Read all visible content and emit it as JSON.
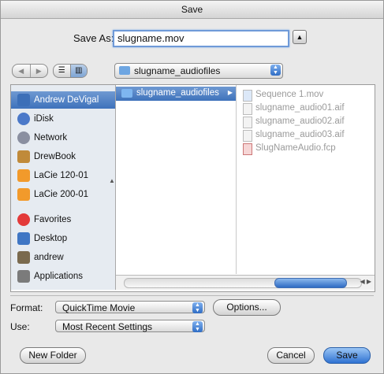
{
  "window": {
    "title": "Save"
  },
  "saveas": {
    "label": "Save As:",
    "value": "slugname.mov",
    "disclosure_icon": "triangle-up"
  },
  "toolbar": {
    "back_icon": "◀",
    "forward_icon": "▶",
    "list_view_icon": "☰",
    "column_view_icon": "▥",
    "path_value": "slugname_audiofiles"
  },
  "sidebar": {
    "items": [
      {
        "label": "Andrew DeVigal",
        "icon": "computer-icon",
        "color": "#3c6fb8"
      },
      {
        "label": "iDisk",
        "icon": "idisk-icon",
        "color": "#4b79c9"
      },
      {
        "label": "Network",
        "icon": "network-icon",
        "color": "#8a8fa0"
      },
      {
        "label": "DrewBook",
        "icon": "drive-icon",
        "color": "#c08a3a"
      },
      {
        "label": "LaCie 120-01",
        "icon": "disk-icon",
        "color": "#f29a2b"
      },
      {
        "label": "LaCie 200-01",
        "icon": "disk-icon",
        "color": "#f29a2b"
      },
      {
        "label": "Favorites",
        "icon": "heart-icon",
        "color": "#e33a3a"
      },
      {
        "label": "Desktop",
        "icon": "desktop-icon",
        "color": "#3f76c4"
      },
      {
        "label": "andrew",
        "icon": "home-icon",
        "color": "#7a6a4e"
      },
      {
        "label": "Applications",
        "icon": "applications-icon",
        "color": "#7b7b7b"
      }
    ]
  },
  "columns": {
    "col1_selected": "slugname_audiofiles",
    "files": [
      "Sequence 1.mov",
      "slugname_audio01.aif",
      "slugname_audio02.aif",
      "slugname_audio03.aif",
      "SlugNameAudio.fcp"
    ]
  },
  "options": {
    "format_label": "Format:",
    "format_value": "QuickTime Movie",
    "options_button": "Options...",
    "use_label": "Use:",
    "use_value": "Most Recent Settings"
  },
  "buttons": {
    "new_folder": "New Folder",
    "cancel": "Cancel",
    "save": "Save"
  },
  "colors": {
    "selection": "#3e72bb",
    "default_button": "#2f72d2"
  }
}
